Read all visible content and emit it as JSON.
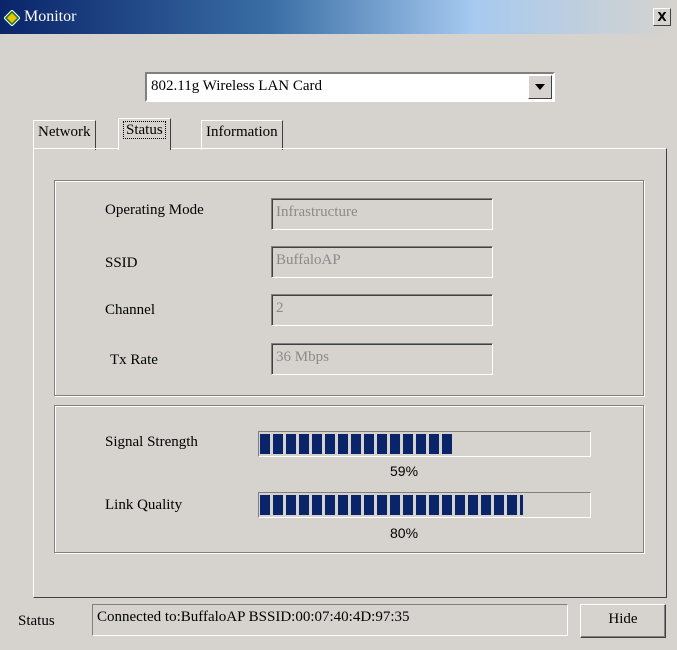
{
  "window": {
    "title": "Monitor",
    "close_label": "X"
  },
  "adapter": {
    "selected": "802.11g Wireless LAN Card"
  },
  "tabs": [
    {
      "label": "Network"
    },
    {
      "label": "Status"
    },
    {
      "label": "Information"
    }
  ],
  "active_tab": "Status",
  "connection": {
    "fields": [
      {
        "label": "Operating Mode",
        "value": "Infrastructure"
      },
      {
        "label": "SSID",
        "value": "BuffaloAP"
      },
      {
        "label": "Channel",
        "value": "2"
      },
      {
        "label": "Tx Rate",
        "value": "36 Mbps"
      }
    ]
  },
  "signal": {
    "strength_label": "Signal Strength",
    "strength_percent": 59,
    "strength_text": "59%",
    "quality_label": "Link Quality",
    "quality_percent": 80,
    "quality_text": "80%"
  },
  "footer": {
    "status_label": "Status",
    "status_text": "Connected to:BuffaloAP    BSSID:00:07:40:4D:97:35",
    "hide_label": "Hide"
  },
  "colors": {
    "title_bar": "#0a246a",
    "progress_fill": "#0a246a",
    "face": "#d6d3ce"
  }
}
